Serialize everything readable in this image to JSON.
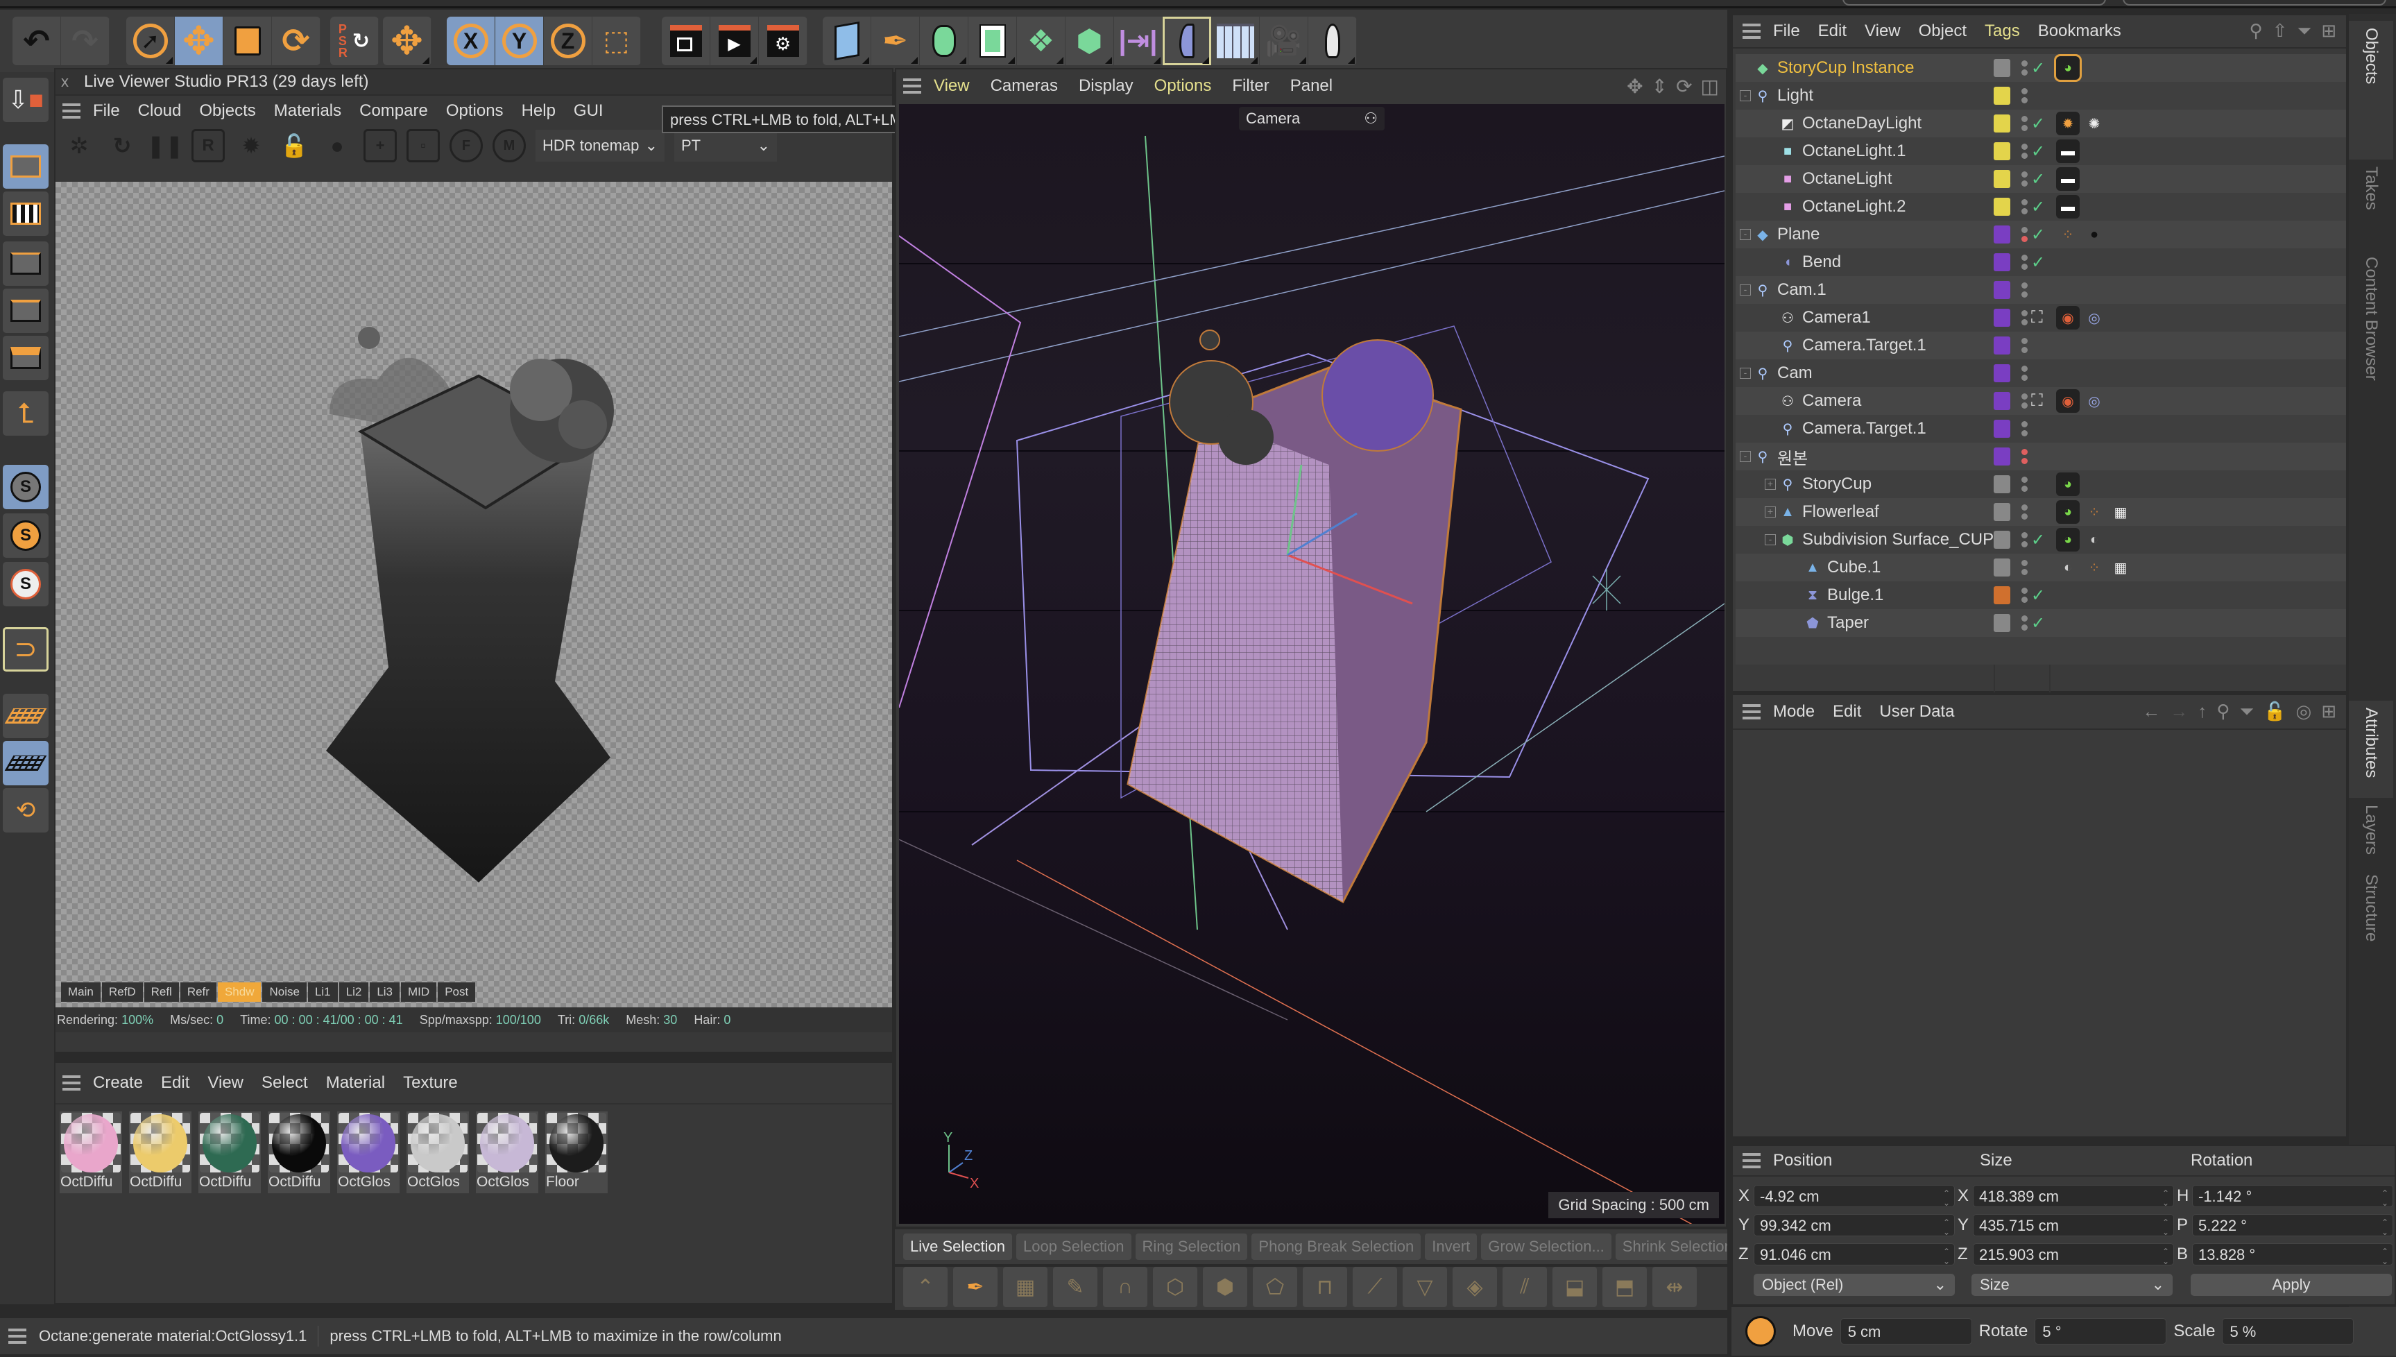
{
  "top_toolbar": {
    "groups": [
      {
        "name": "history",
        "buttons": [
          "undo-icon",
          "redo-icon"
        ]
      },
      {
        "name": "transform",
        "buttons": [
          "live-select-icon",
          "move-icon",
          "scale-icon",
          "rotate-icon"
        ]
      },
      {
        "name": "psr",
        "buttons": [
          "psr-reset-icon"
        ]
      },
      {
        "name": "axis-move",
        "buttons": [
          "world-move-icon"
        ]
      },
      {
        "name": "axes",
        "labels": [
          "X",
          "Y",
          "Z"
        ],
        "active": [
          "X",
          "Y"
        ]
      },
      {
        "name": "coordinate",
        "buttons": [
          "coordinate-system-icon"
        ]
      },
      {
        "name": "render",
        "buttons": [
          "render-view-icon",
          "render-picture-viewer-icon",
          "render-settings-icon"
        ]
      },
      {
        "name": "create",
        "buttons": [
          "cube-icon",
          "pen-icon",
          "subdivision-icon",
          "extrude-icon",
          "cloner-icon",
          "mograph-icon",
          "symmetry-icon",
          "bend-deformer-icon",
          "floor-icon",
          "camera-icon",
          "light-icon"
        ]
      }
    ]
  },
  "left_palette": [
    "make-editable",
    "model-mode",
    "texture-mode",
    "points-mode",
    "edges-mode",
    "polygons-mode",
    "axis-mode",
    "solo-off",
    "solo-single",
    "solo-hierarchy",
    "snap-enable",
    "workplane",
    "lock-workplane",
    "align-workplane"
  ],
  "live_viewer": {
    "title": "Live Viewer Studio PR13 (29 days left)",
    "close": "x",
    "menu": [
      "File",
      "Cloud",
      "Objects",
      "Materials",
      "Compare",
      "Options",
      "Help",
      "GUI"
    ],
    "tools": [
      "octane-icon",
      "restart-icon",
      "pause-icon",
      "R",
      "settings-icon",
      "lock-icon",
      "material-ball-icon",
      "region-add-icon",
      "region-icon",
      "F",
      "M"
    ],
    "tonemap": "HDR tonemap",
    "kernel": "PT",
    "passes": [
      "Main",
      "RefD",
      "Refl",
      "Refr",
      "Shdw",
      "Noise",
      "Li1",
      "Li2",
      "Li3",
      "MID",
      "Post"
    ],
    "active_pass": "Shdw",
    "stats": {
      "rendering_label": "Rendering:",
      "rendering": "100%",
      "mssec_label": "Ms/sec:",
      "mssec": "0",
      "time_label": "Time:",
      "time": "00 : 00 : 41/00 : 00 : 41",
      "spp_label": "Spp/maxspp:",
      "spp": "100/100",
      "tri_label": "Tri:",
      "tri": "0/66k",
      "mesh_label": "Mesh:",
      "mesh": "30",
      "hair_label": "Hair:",
      "hair": "0"
    }
  },
  "tooltip": "press CTRL+LMB to fold, ALT+LMB to maximize in the row/column",
  "material_manager": {
    "menu": [
      "Create",
      "Edit",
      "View",
      "Select",
      "Material",
      "Texture"
    ],
    "materials": [
      {
        "label": "OctDiffu",
        "color": "#e9a6cb"
      },
      {
        "label": "OctDiffu",
        "color": "#eccb6b"
      },
      {
        "label": "OctDiffu",
        "color": "#2e6a52"
      },
      {
        "label": "OctDiffu",
        "color": "#0a0a0a"
      },
      {
        "label": "OctGlos",
        "color": "#7a5cc0"
      },
      {
        "label": "OctGlos",
        "color": "#c9c9c9"
      },
      {
        "label": "OctGlos",
        "color": "#c7b8d6"
      },
      {
        "label": "Floor",
        "color": "#1c1c1c"
      }
    ]
  },
  "viewport": {
    "menu": [
      "View",
      "Cameras",
      "Display",
      "Options",
      "Filter",
      "Panel"
    ],
    "highlighted": [
      "View",
      "Options"
    ],
    "camera_label": "Camera",
    "grid_spacing": "Grid Spacing : 500 cm",
    "axis_labels": {
      "x": "X",
      "y": "Y",
      "z": "Z"
    },
    "nav_icons": [
      "pan-icon",
      "zoom-icon",
      "orbit-icon",
      "maximize-view-icon"
    ]
  },
  "selection_bar": {
    "buttons": [
      "Live Selection",
      "Loop Selection",
      "Ring Selection",
      "Phong Break Selection",
      "Invert",
      "Grow Selection...",
      "Shrink Selection"
    ],
    "active": "Live Selection"
  },
  "status_bar": {
    "message": "Octane:generate material:OctGlossy1.1",
    "hint": "press CTRL+LMB to fold, ALT+LMB to maximize in the row/column"
  },
  "object_manager": {
    "menu": [
      "File",
      "Edit",
      "View",
      "Object",
      "Tags",
      "Bookmarks"
    ],
    "highlighted": "Tags",
    "objects": [
      {
        "name": "StoryCup Instance",
        "depth": 0,
        "icon": "instance",
        "color": "#888",
        "check": true,
        "tags": [
          "octane-obj"
        ],
        "selected": true
      },
      {
        "name": "Light",
        "depth": 0,
        "icon": "null",
        "fold": "-",
        "color": "#e3d44b",
        "check": false,
        "tags": []
      },
      {
        "name": "OctaneDayLight",
        "depth": 1,
        "icon": "daylight",
        "color": "#e3d44b",
        "check": true,
        "tags": [
          "sun",
          "sun-white"
        ]
      },
      {
        "name": "OctaneLight.1",
        "depth": 1,
        "icon": "light-cyan",
        "color": "#e3d44b",
        "check": true,
        "tags": [
          "arealight"
        ]
      },
      {
        "name": "OctaneLight",
        "depth": 1,
        "icon": "light-pink",
        "color": "#e3d44b",
        "check": true,
        "tags": [
          "arealight"
        ]
      },
      {
        "name": "OctaneLight.2",
        "depth": 1,
        "icon": "light-pink",
        "color": "#e3d44b",
        "check": true,
        "tags": [
          "arealight"
        ]
      },
      {
        "name": "Plane",
        "depth": 0,
        "icon": "plane",
        "fold": "-",
        "color": "#7a3ec2",
        "check": true,
        "red": true,
        "tags": [
          "phong",
          "material-black"
        ]
      },
      {
        "name": "Bend",
        "depth": 1,
        "icon": "bend",
        "color": "#7a3ec2",
        "check": true,
        "tags": []
      },
      {
        "name": "Cam.1",
        "depth": 0,
        "icon": "null",
        "fold": "-",
        "color": "#7a3ec2",
        "check": false,
        "tags": []
      },
      {
        "name": "Camera1",
        "depth": 1,
        "icon": "camera",
        "color": "#7a3ec2",
        "check": false,
        "frame": true,
        "tags": [
          "octane-camera",
          "target"
        ]
      },
      {
        "name": "Camera.Target.1",
        "depth": 1,
        "icon": "null",
        "color": "#7a3ec2",
        "check": false,
        "tags": []
      },
      {
        "name": "Cam",
        "depth": 0,
        "icon": "null",
        "fold": "-",
        "color": "#7a3ec2",
        "check": false,
        "tags": []
      },
      {
        "name": "Camera",
        "depth": 1,
        "icon": "camera",
        "color": "#7a3ec2",
        "check": false,
        "frame": true,
        "tags": [
          "octane-camera",
          "target"
        ]
      },
      {
        "name": "Camera.Target.1",
        "depth": 1,
        "icon": "null",
        "color": "#7a3ec2",
        "check": false,
        "tags": []
      },
      {
        "name": "원본",
        "depth": 0,
        "icon": "null",
        "fold": "-",
        "color": "#7a3ec2",
        "check": false,
        "red_both": true,
        "tags": []
      },
      {
        "name": "StoryCup",
        "depth": 1,
        "icon": "null",
        "fold": "+",
        "color": "#888",
        "check": false,
        "tags": [
          "octane-obj"
        ]
      },
      {
        "name": "Flowerleaf",
        "depth": 1,
        "icon": "polygon",
        "fold": "+",
        "color": "#888",
        "check": false,
        "tags": [
          "octane-obj",
          "phong",
          "uvw"
        ]
      },
      {
        "name": "Subdivision Surface_CUP",
        "depth": 1,
        "icon": "subdivision",
        "fold": "-",
        "color": "#888",
        "check": true,
        "tags": [
          "octane-obj",
          "material-glossy"
        ]
      },
      {
        "name": "Cube.1",
        "depth": 2,
        "icon": "polygon",
        "color": "#888",
        "check": false,
        "tags": [
          "material-glossy",
          "phong",
          "uvw"
        ]
      },
      {
        "name": "Bulge.1",
        "depth": 2,
        "icon": "bulge",
        "color": "#d0702e",
        "check": true,
        "tags": []
      },
      {
        "name": "Taper",
        "depth": 2,
        "icon": "taper",
        "color": "#888",
        "check": true,
        "tags": []
      }
    ]
  },
  "side_tabs_top": [
    "Objects",
    "Takes",
    "Content Browser"
  ],
  "side_tabs_bottom": [
    "Attributes",
    "Layers",
    "Structure"
  ],
  "attributes": {
    "menu": [
      "Mode",
      "Edit",
      "User Data"
    ]
  },
  "coordinates": {
    "headers": [
      "Position",
      "Size",
      "Rotation"
    ],
    "position": [
      {
        "axis": "X",
        "value": "-4.92 cm"
      },
      {
        "axis": "Y",
        "value": "99.342 cm"
      },
      {
        "axis": "Z",
        "value": "91.046 cm"
      }
    ],
    "size": [
      {
        "axis": "X",
        "value": "418.389 cm"
      },
      {
        "axis": "Y",
        "value": "435.715 cm"
      },
      {
        "axis": "Z",
        "value": "215.903 cm"
      }
    ],
    "rotation": [
      {
        "axis": "H",
        "value": "-1.142 °"
      },
      {
        "axis": "P",
        "value": "5.222 °"
      },
      {
        "axis": "B",
        "value": "13.828 °"
      }
    ],
    "mode": "Object (Rel)",
    "size_mode": "Size",
    "apply": "Apply"
  },
  "snap_bar": {
    "move_label": "Move",
    "move": "5 cm",
    "rotate_label": "Rotate",
    "rotate": "5 °",
    "scale_label": "Scale",
    "scale": "5 %"
  }
}
